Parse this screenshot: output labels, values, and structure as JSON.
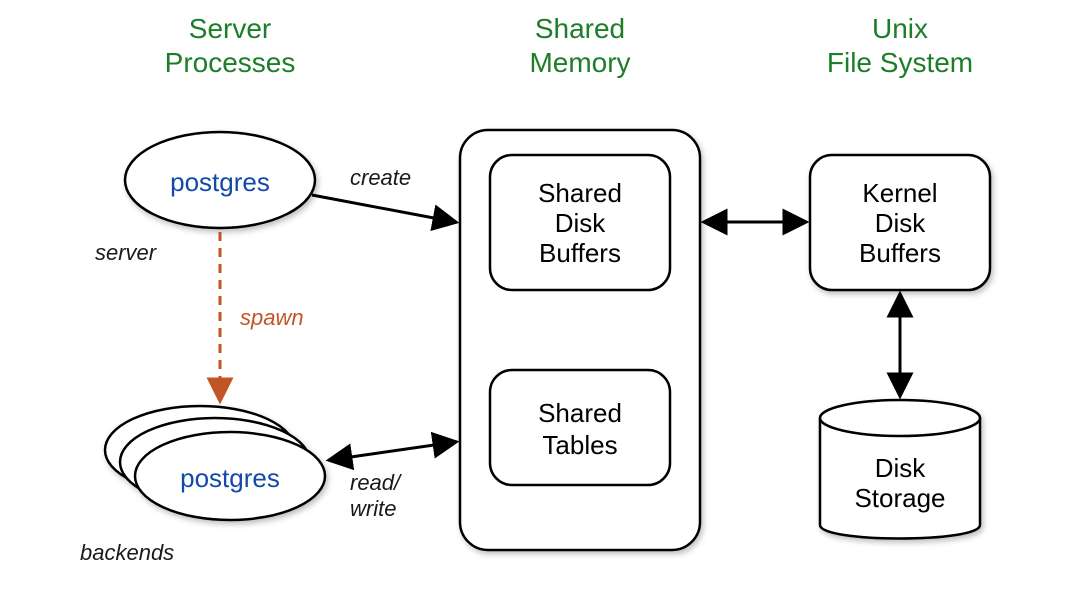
{
  "columns": {
    "server_processes": {
      "line1": "Server",
      "line2": "Processes"
    },
    "shared_memory": {
      "line1": "Shared",
      "line2": "Memory"
    },
    "unix_fs": {
      "line1": "Unix",
      "line2": "File System"
    }
  },
  "nodes": {
    "postgres_server": "postgres",
    "postgres_backend": "postgres",
    "shared_disk_buffers": {
      "l1": "Shared",
      "l2": "Disk",
      "l3": "Buffers"
    },
    "shared_tables": {
      "l1": "Shared",
      "l2": "Tables"
    },
    "kernel_disk_buffers": {
      "l1": "Kernel",
      "l2": "Disk",
      "l3": "Buffers"
    },
    "disk_storage": {
      "l1": "Disk",
      "l2": "Storage"
    }
  },
  "labels": {
    "server": "server",
    "backends": "backends",
    "spawn": "spawn",
    "create": "create",
    "read_write_l1": "read/",
    "read_write_l2": "write"
  },
  "colors": {
    "title_green": "#1d7d28",
    "postgres_blue": "#1349a8",
    "spawn_orange": "#c15526",
    "stroke": "#000000"
  }
}
